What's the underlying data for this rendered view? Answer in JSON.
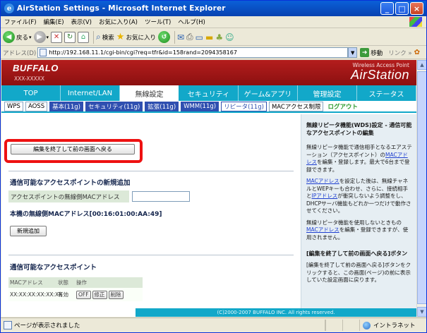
{
  "window": {
    "title": "AirStation Settings - Microsoft Internet Explorer",
    "minimize": "_",
    "maximize": "□",
    "close": "×"
  },
  "menu": [
    "ファイル(F)",
    "編集(E)",
    "表示(V)",
    "お気に入り(A)",
    "ツール(T)",
    "ヘルプ(H)"
  ],
  "toolbar": {
    "back": "戻る",
    "search": "検索",
    "favorites": "お気に入り"
  },
  "address": {
    "label": "アドレス(D)",
    "url": "http://192.168.11.1/cgi-bin/cgi?req=tfr&id=158rand=2094358167",
    "go": "移動",
    "links": "リンク »"
  },
  "header": {
    "brand": "BUFFALO",
    "model": "XXX-XXXXX",
    "tagline": "Wireless Access Point",
    "product": "AirStation"
  },
  "main_tabs": [
    {
      "label": "TOP"
    },
    {
      "label": "Internet/LAN"
    },
    {
      "label": "無線設定"
    },
    {
      "label": "セキュリティ"
    },
    {
      "label": "ゲーム&アプリ"
    },
    {
      "label": "管理設定"
    },
    {
      "label": "ステータス"
    }
  ],
  "sub_tabs": [
    {
      "label": "WPS"
    },
    {
      "label": "AOSS"
    },
    {
      "label": "基本(11g)"
    },
    {
      "label": "セキュリティ(11g)"
    },
    {
      "label": "拡張(11g)"
    },
    {
      "label": "WMM(11g)"
    },
    {
      "label": "リピータ(11g)"
    },
    {
      "label": "MACアクセス制限"
    },
    {
      "label": "ログアウト"
    }
  ],
  "main": {
    "back_button": "編集を終了して前の画面へ戻る",
    "add_section_title": "通信可能なアクセスポイントの新規追加",
    "mac_label": "アクセスポイントの無線側MACアドレス",
    "mac_value": "",
    "own_mac": "本機の無線側MACアドレス[00:16:01:00:AA:49]",
    "add_button": "新規追加",
    "list_section_title": "通信可能なアクセスポイント",
    "table_headers": [
      "MACアドレス",
      "状態",
      "操作"
    ],
    "table_rows": [
      {
        "mac": "XX:XX:XX:XX:XX:XX",
        "status": "有効",
        "off": "OFF",
        "edit": "修正",
        "delete": "削除"
      }
    ],
    "footer": "(C)2000-2007 BUFFALO INC. All rights reserved."
  },
  "help": {
    "title": "無線リピータ機能(WDS)設定 - 通信可能なアクセスポイントの編集",
    "p1_a": "無線リピータ機能で通信相手となるエアステーション（アクセスポイント）の",
    "p1_link": "MACアドレス",
    "p1_b": "を編集・登録します。最大で6台まで登録できます。",
    "p2_link1": "MACアドレス",
    "p2_a": "を設定した後は、無線チャネルとWEPキーも合わせ、さらに、接続相手と",
    "p2_link2": "IPアドレス",
    "p2_b": "が衝突しないよう調整をし、DHCPサーバ機能もどれか一つだけで動作させてください。",
    "p3_a": "無線リピータ機能を使用しないときもの",
    "p3_link": "MACアドレス",
    "p3_b": "を編集・登録できますが、使用されません。",
    "sub_title": "[編集を終了して前の画面へ戻る]ボタン",
    "p4": "[編集を終了して前の画面へ戻る]ボタンをクリックすると、この画面(ページ)の前に表示していた設定画面に戻ります。"
  },
  "status": {
    "text": "ページが表示されました",
    "zone": "イントラネット"
  }
}
